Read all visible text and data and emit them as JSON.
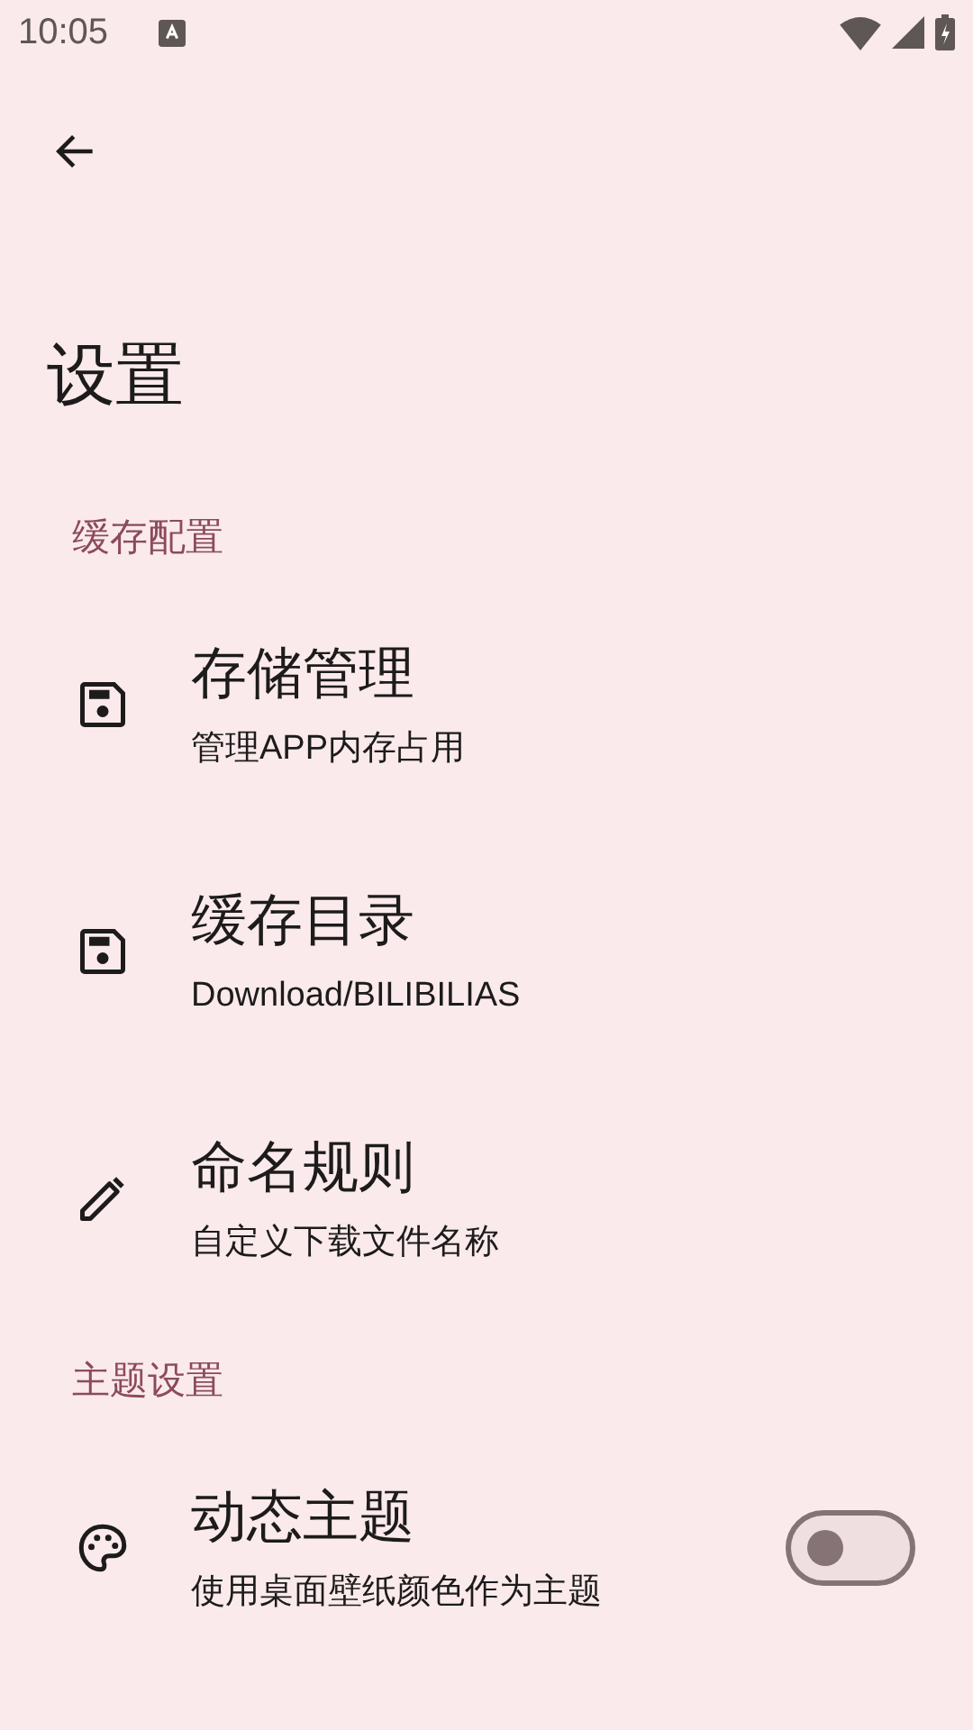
{
  "status_bar": {
    "time": "10:05"
  },
  "app_bar": {
    "title": "设置"
  },
  "sections": [
    {
      "header": "缓存配置",
      "items": [
        {
          "kind": "disk",
          "title": "存储管理",
          "subtitle": "管理APP内存占用"
        },
        {
          "kind": "disk",
          "title": "缓存目录",
          "subtitle": "Download/BILIBILIAS"
        },
        {
          "kind": "pencil",
          "title": "命名规则",
          "subtitle": "自定义下载文件名称"
        }
      ]
    },
    {
      "header": "主题设置",
      "items": [
        {
          "kind": "palette",
          "title": "动态主题",
          "subtitle": "使用桌面壁纸颜色作为主题",
          "on": false
        }
      ]
    }
  ]
}
